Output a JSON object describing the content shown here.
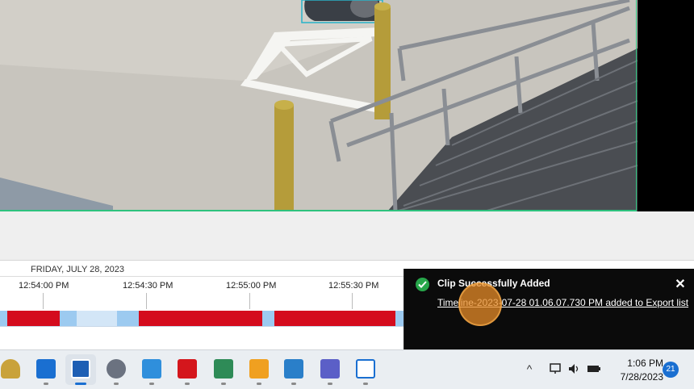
{
  "timeline": {
    "date_label": "FRIDAY, JULY 28, 2023",
    "ticks": [
      "12:54:00 PM",
      "12:54:30 PM",
      "12:55:00 PM",
      "12:55:30 PM"
    ],
    "segment_colors": {
      "recorded": "#d40b1d",
      "motion": "#9ccaf0",
      "empty": "#d3e6f7"
    }
  },
  "toast": {
    "title": "Clip Successfully Added",
    "message": "Timeline-2023-07-28 01.06.07.730 PM added to Export list",
    "close_glyph": "✕"
  },
  "taskbar": {
    "apps": [
      {
        "name": "mail-security-icon",
        "color": "#c9a23a"
      },
      {
        "name": "outlook-icon",
        "color": "#1a6fd1"
      },
      {
        "name": "video-surveillance-icon",
        "color": "#1e5fb4"
      },
      {
        "name": "settings-icon",
        "color": "#6b7280"
      },
      {
        "name": "notepad-icon",
        "color": "#2f8fdc"
      },
      {
        "name": "acrobat-icon",
        "color": "#d4161c"
      },
      {
        "name": "spreadsheet-icon",
        "color": "#2e8b57"
      },
      {
        "name": "presentation-icon",
        "color": "#f0a020"
      },
      {
        "name": "snagit-icon",
        "color": "#2a7fc9"
      },
      {
        "name": "teams-icon",
        "color": "#5b5fc7"
      },
      {
        "name": "window-app-icon",
        "color": "#1a6fd1"
      }
    ],
    "clock_time": "1:06 PM",
    "clock_date": "7/28/2023",
    "notification_count": "21"
  }
}
